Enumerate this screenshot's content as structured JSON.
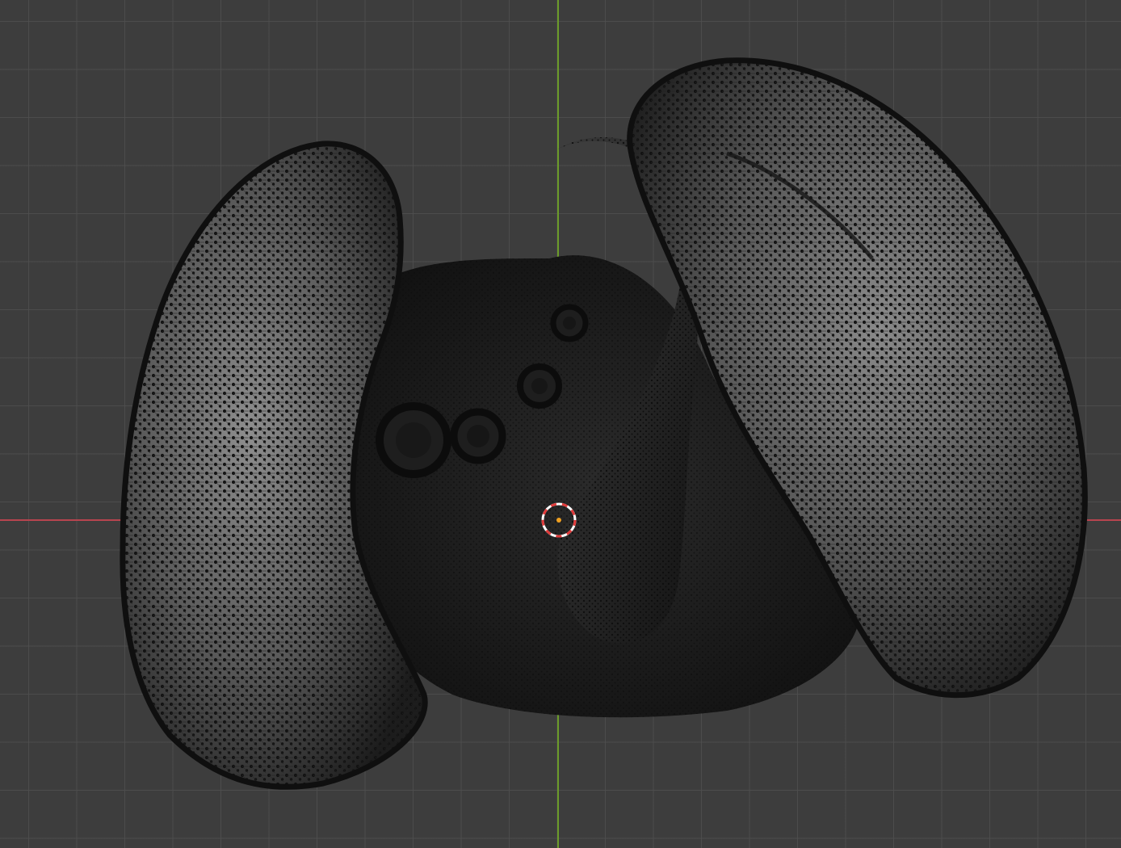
{
  "viewport": {
    "background_color": "#3d3d3d",
    "grid_color": "#4e4e4e",
    "axis_x_color": "#b8444f",
    "axis_y_color": "#6c9b2a"
  },
  "object": {
    "name_icon": "mesh-object-icon",
    "mesh_color": "#1a1a1a",
    "surface_highlight": "#9a9a9a",
    "vertex_color": "#111111"
  },
  "cursor_3d": {
    "icon": "3d-cursor-icon",
    "ring_color_a": "#e03a3a",
    "ring_color_b": "#ffffff",
    "origin_color": "#f0a020"
  }
}
